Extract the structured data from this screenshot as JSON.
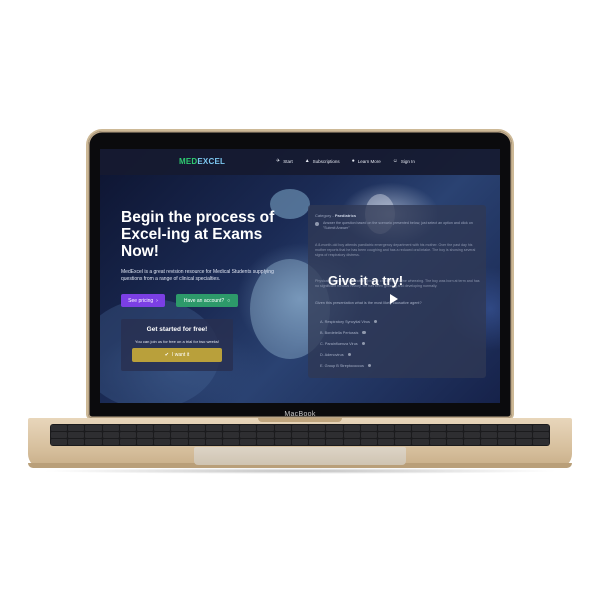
{
  "device": {
    "brand_label": "MacBook"
  },
  "nav": {
    "logo_part1": "MED",
    "logo_part2": "EXCEL",
    "items": [
      {
        "label": "Start",
        "icon": "rocket-icon"
      },
      {
        "label": "Subscriptions",
        "icon": "graduation-cap-icon"
      },
      {
        "label": "Learn More",
        "icon": "lightbulb-icon"
      },
      {
        "label": "Sign In",
        "icon": "user-icon"
      }
    ]
  },
  "hero": {
    "title": "Begin the process of Excel-ing at Exams Now!",
    "description": "MedExcel is a great revision resource for Medical Students supplying questions from a range of clinical specialties.",
    "pricing_button": "See pricing",
    "account_button": "Have an account?"
  },
  "signup_card": {
    "title": "Get started for free!",
    "subtitle": "You can join us for free on a trial for two weeks!",
    "button": "I want it"
  },
  "question_panel": {
    "category_label": "Category -",
    "category_value": "Paediatrics",
    "instruction": "Answer the question based on the scenario presented below, just select an option and click on \"Submit Answer\"",
    "scenario_1": "A 8-month-old boy attends paediatric emergency department with his mother. Over the past day his mother reports that he has been coughing and has a reduced oral intake. The boy is showing several signs of respiratory distress.",
    "scenario_2": "Physical examination reveals inspiratory crackles and fine wheezing. The boy was born at term and has no significant medical history. He has been growing and developing normally.",
    "question": "Given this presentation what is the most likely causative agent?",
    "options": [
      "A. Respiratory Syncytial Virus",
      "B. Bordetella Pertussis",
      "C. Parainfluenza Virus",
      "D. Adenovirus",
      "E. Group B Streptococcus"
    ],
    "overlay_label": "Give it a try!"
  },
  "colors": {
    "accent_purple": "#7b3fe4",
    "accent_green": "#2d9a6a",
    "accent_gold": "#b9a03b",
    "logo_green": "#2ecb71",
    "logo_blue": "#7cc7f0"
  }
}
